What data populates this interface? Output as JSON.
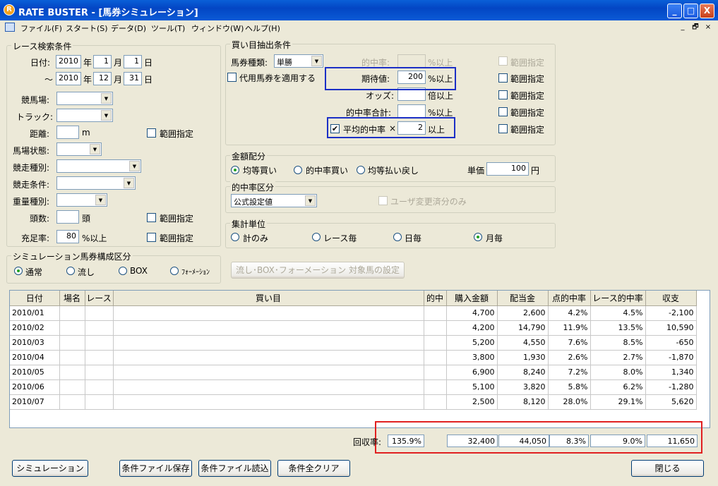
{
  "window": {
    "title": "RATE BUSTER - [馬券シミュレーション]",
    "app_icon": "app-logo-icon",
    "min": "_",
    "max": "□",
    "close": "X"
  },
  "menu": {
    "items": [
      "ファイル(F)",
      "スタート(S)",
      "データ(D)",
      "ツール(T)",
      "ウィンドウ(W)",
      "ヘルプ(H)"
    ],
    "mdi": [
      "_",
      "🗗",
      "×"
    ]
  },
  "race": {
    "group": "レース検索条件",
    "date_label": "日付:",
    "tilde": "～",
    "from": {
      "year": "2010",
      "y_unit": "年",
      "month": "1",
      "m_unit": "月",
      "day": "1",
      "d_unit": "日"
    },
    "to": {
      "year": "2010",
      "y_unit": "年",
      "month": "12",
      "m_unit": "月",
      "day": "31",
      "d_unit": "日"
    },
    "venue": "競馬場:",
    "track": "トラック:",
    "distance": "距離:",
    "distance_unit": "m",
    "range": "範囲指定",
    "condition": "馬場状態:",
    "race_type": "競走種別:",
    "race_cond": "競走条件:",
    "weight_type": "重量種別:",
    "heads": "頭数:",
    "heads_unit": "頭",
    "fill_rate": "充足率:",
    "fill_value": "80",
    "fill_unit": "%以上"
  },
  "sim": {
    "group": "シミュレーション馬券構成区分",
    "options": [
      "通常",
      "流し",
      "BOX",
      "ﾌｫｰﾒｰｼｮﾝ"
    ],
    "selected": 0,
    "nagashi_btn": "流し･BOX･フォーメーション 対象馬の設定"
  },
  "buy": {
    "group": "買い目抽出条件",
    "ticket_label": "馬券種類:",
    "ticket_value": "単勝",
    "substitute": "代用馬券を適用する",
    "hit_rate": "的中率:",
    "hit_rate_unit": "%以上",
    "expected": "期待値:",
    "expected_value": "200",
    "expected_unit": "%以上",
    "odds": "オッズ:",
    "odds_unit": "倍以上",
    "hit_total": "的中率合計:",
    "hit_total_unit": "%以上",
    "avg_hit": "平均的中率",
    "avg_mult": "×",
    "avg_value": "2",
    "avg_unit": "以上",
    "avg_check": "✔",
    "range": "範囲指定"
  },
  "money": {
    "group": "金額配分",
    "options": [
      "均等買い",
      "的中率買い",
      "均等払い戻し"
    ],
    "selected": 0,
    "unit_label": "単価",
    "unit_value": "100",
    "unit_yen": "円"
  },
  "hitkbn": {
    "group": "的中率区分",
    "value": "公式設定値",
    "user_only": "ユーザ変更済分のみ"
  },
  "agg": {
    "group": "集計単位",
    "options": [
      "計のみ",
      "レース毎",
      "日毎",
      "月毎"
    ],
    "selected": 3
  },
  "table": {
    "headers": [
      "日付",
      "場名",
      "レース",
      "買い目",
      "的中",
      "購入金額",
      "配当金",
      "点的中率",
      "レース的中率",
      "収支"
    ],
    "rows": [
      [
        "2010/01",
        "",
        "",
        "",
        "",
        "4,700",
        "2,600",
        "4.2%",
        "4.5%",
        "-2,100"
      ],
      [
        "2010/02",
        "",
        "",
        "",
        "",
        "4,200",
        "14,790",
        "11.9%",
        "13.5%",
        "10,590"
      ],
      [
        "2010/03",
        "",
        "",
        "",
        "",
        "5,200",
        "4,550",
        "7.6%",
        "8.5%",
        "-650"
      ],
      [
        "2010/04",
        "",
        "",
        "",
        "",
        "3,800",
        "1,930",
        "2.6%",
        "2.7%",
        "-1,870"
      ],
      [
        "2010/05",
        "",
        "",
        "",
        "",
        "6,900",
        "8,240",
        "7.2%",
        "8.0%",
        "1,340"
      ],
      [
        "2010/06",
        "",
        "",
        "",
        "",
        "5,100",
        "3,820",
        "5.8%",
        "6.2%",
        "-1,280"
      ],
      [
        "2010/07",
        "",
        "",
        "",
        "",
        "2,500",
        "8,120",
        "28.0%",
        "29.1%",
        "5,620"
      ]
    ]
  },
  "summary": {
    "label": "回収率:",
    "rate": "135.9%",
    "purchase": "32,400",
    "payout": "44,050",
    "point_hit": "8.3%",
    "race_hit": "9.0%",
    "balance": "11,650"
  },
  "buttons": {
    "simulate": "シミュレーション",
    "save": "条件ファイル保存",
    "load": "条件ファイル読込",
    "clear": "条件全クリア",
    "close": "閉じる"
  }
}
